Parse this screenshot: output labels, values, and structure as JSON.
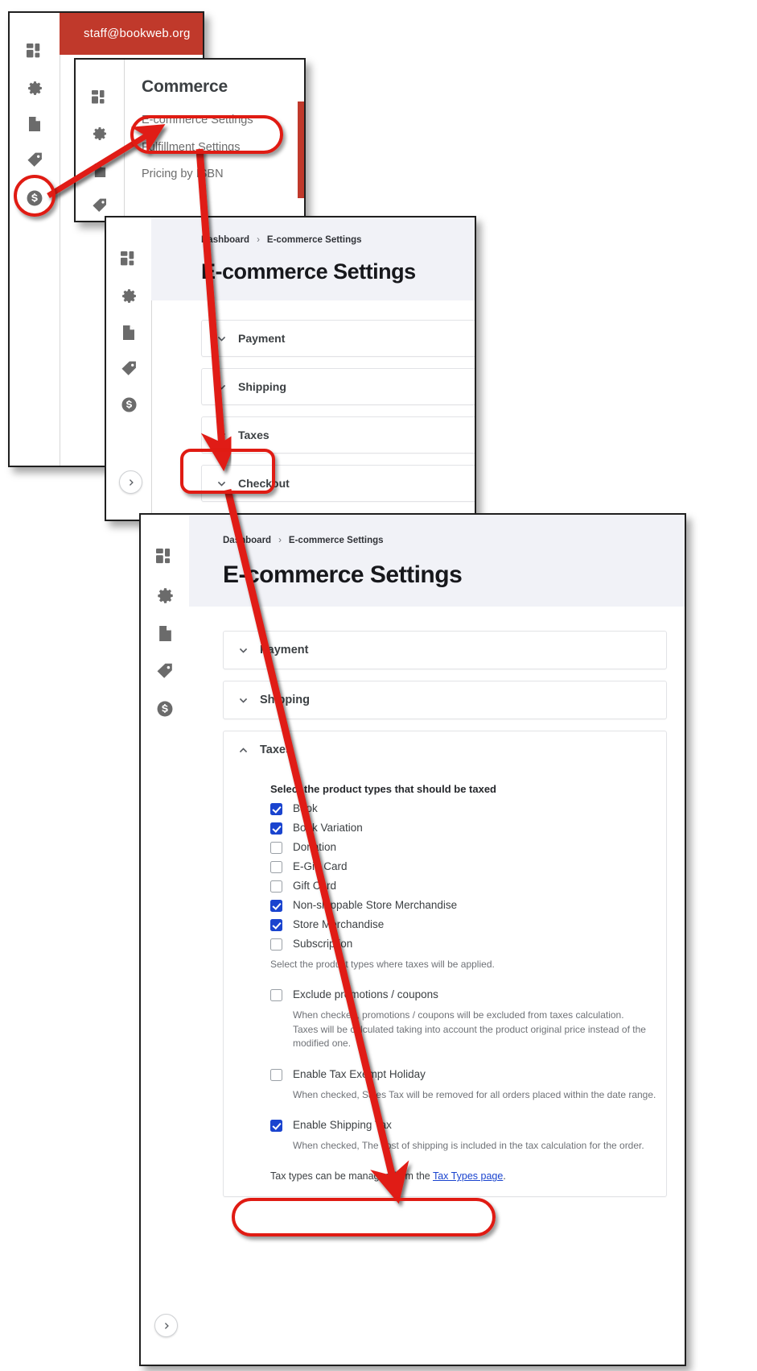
{
  "app": {
    "account_email": "staff@bookweb.org",
    "brand_color": "#c0392b",
    "accent_color": "#1a44cf",
    "annotation_color": "#e01b13"
  },
  "rail_icons": [
    {
      "name": "dashboard-icon",
      "label": "Dashboard"
    },
    {
      "name": "gear-icon",
      "label": "Settings"
    },
    {
      "name": "book-icon",
      "label": "Catalog"
    },
    {
      "name": "tag-icon",
      "label": "Promotions"
    },
    {
      "name": "dollar-icon",
      "label": "Commerce"
    }
  ],
  "commerce_menu": {
    "title": "Commerce",
    "items": [
      {
        "label": "E-commerce Settings",
        "highlighted": true
      },
      {
        "label": "Fulfillment Settings",
        "highlighted": false
      },
      {
        "label": "Pricing by ISBN",
        "highlighted": false
      }
    ]
  },
  "breadcrumb": {
    "root": "Dashboard",
    "separator": "›",
    "current": "E-commerce Settings"
  },
  "page": {
    "title": "E-commerce Settings"
  },
  "accordions_mid": [
    {
      "label": "Payment",
      "state": "collapsed"
    },
    {
      "label": "Shipping",
      "state": "collapsed"
    },
    {
      "label": "Taxes",
      "state": "collapsed"
    },
    {
      "label": "Checkout",
      "state": "collapsed"
    }
  ],
  "accordions_front": [
    {
      "label": "Payment",
      "state": "collapsed"
    },
    {
      "label": "Shipping",
      "state": "collapsed"
    },
    {
      "label": "Taxes",
      "state": "expanded"
    }
  ],
  "taxes_panel": {
    "section_label": "Taxes",
    "product_types_title": "Select the product types that should be taxed",
    "product_types": [
      {
        "label": "Book",
        "checked": true
      },
      {
        "label": "Book Variation",
        "checked": true
      },
      {
        "label": "Donation",
        "checked": false
      },
      {
        "label": "E-Gift Card",
        "checked": false
      },
      {
        "label": "Gift Card",
        "checked": false
      },
      {
        "label": "Non-shippable Store Merchandise",
        "checked": true
      },
      {
        "label": "Store Merchandise",
        "checked": true
      },
      {
        "label": "Subscription",
        "checked": false
      }
    ],
    "product_types_hint": "Select the product types where taxes will be applied.",
    "options": [
      {
        "label": "Exclude promotions / coupons",
        "checked": false,
        "hint_line1": "When checked, promotions / coupons will be excluded from taxes calculation.",
        "hint_line2": "Taxes will be calculated taking into account the product original price instead of the modified one."
      },
      {
        "label": "Enable Tax Exempt Holiday",
        "checked": false,
        "hint_line1": "When checked, Sales Tax will be removed for all orders placed within the date range.",
        "hint_line2": ""
      },
      {
        "label": "Enable Shipping Tax",
        "checked": true,
        "hint_line1": "When checked, The cost of shipping is included in the tax calculation for the order.",
        "hint_line2": ""
      }
    ],
    "footer_note_prefix": "Tax types can be managed from the ",
    "footer_note_link": "Tax Types page",
    "footer_note_suffix": "."
  },
  "annotations": {
    "step1_target": "dollar-icon in rail",
    "step2_target": "E-commerce Settings menu item",
    "step3_target": "Taxes accordion header",
    "step4_target": "Tax types footer note"
  }
}
